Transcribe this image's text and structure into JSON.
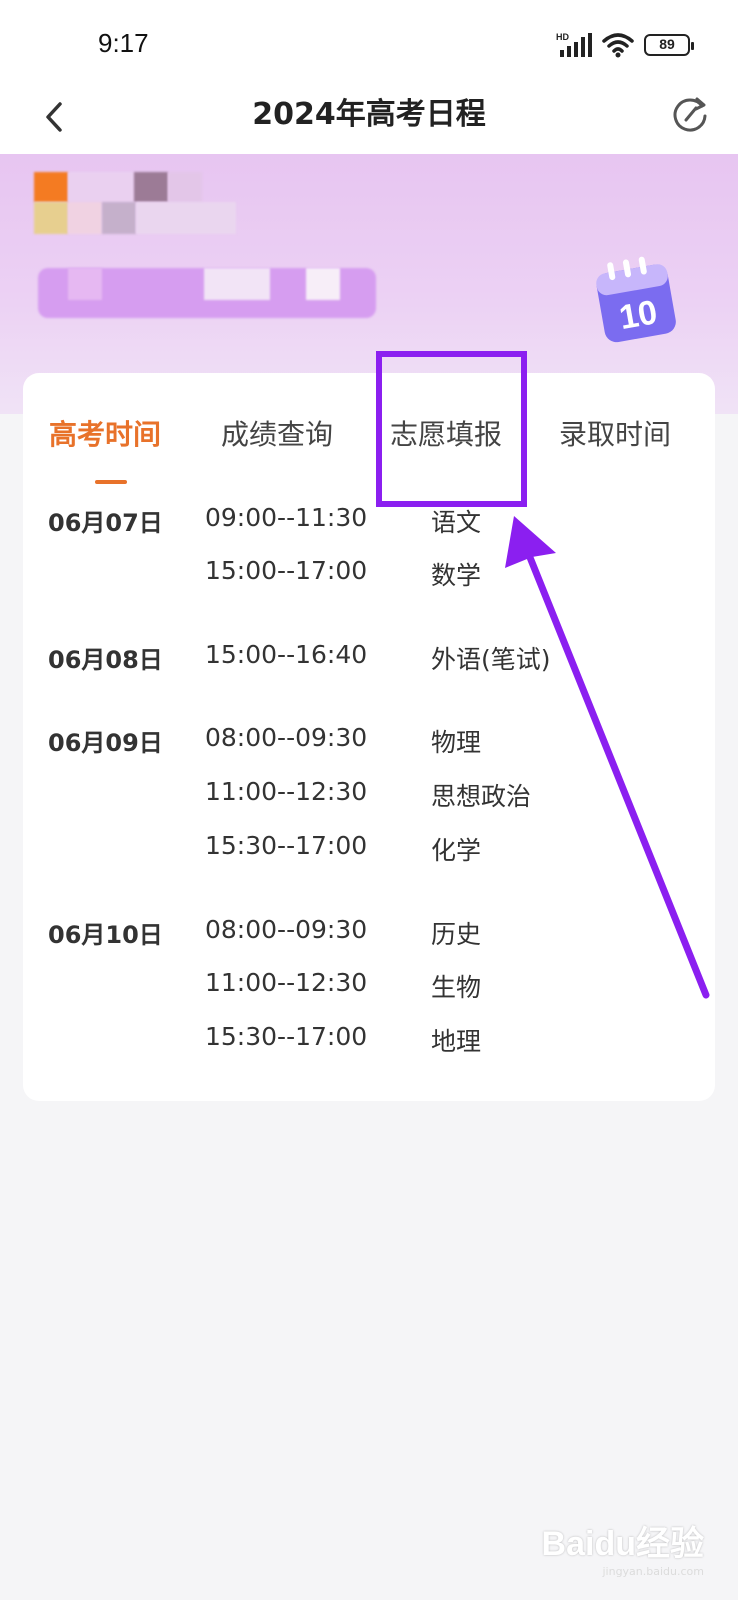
{
  "status_bar": {
    "time": "9:17",
    "network": "HD",
    "battery": "89"
  },
  "header": {
    "title": "2024年高考日程",
    "back_icon": "chevron-left-icon",
    "refresh_icon": "refresh-icon"
  },
  "banner": {
    "calendar_icon": "calendar-icon",
    "calendar_number": "10"
  },
  "tabs": [
    {
      "label": "高考时间",
      "active": true
    },
    {
      "label": "成绩查询",
      "active": false
    },
    {
      "label": "志愿填报",
      "active": false
    },
    {
      "label": "录取时间",
      "active": false
    }
  ],
  "schedule": [
    {
      "date": "06月07日",
      "items": [
        {
          "time": "09:00--11:30",
          "subject": "语文"
        },
        {
          "time": "15:00--17:00",
          "subject": "数学"
        }
      ]
    },
    {
      "date": "06月08日",
      "items": [
        {
          "time": "15:00--16:40",
          "subject": "外语(笔试)"
        }
      ]
    },
    {
      "date": "06月09日",
      "items": [
        {
          "time": "08:00--09:30",
          "subject": "物理"
        },
        {
          "time": "11:00--12:30",
          "subject": "思想政治"
        },
        {
          "time": "15:30--17:00",
          "subject": "化学"
        }
      ]
    },
    {
      "date": "06月10日",
      "items": [
        {
          "time": "08:00--09:30",
          "subject": "历史"
        },
        {
          "time": "11:00--12:30",
          "subject": "生物"
        },
        {
          "time": "15:30--17:00",
          "subject": "地理"
        }
      ]
    }
  ],
  "colors": {
    "accent": "#e8722a",
    "annotation": "#8b1ff0",
    "banner": "#e7c5f1"
  },
  "watermark": {
    "logo": "Baidu经验",
    "url": "jingyan.baidu.com"
  }
}
